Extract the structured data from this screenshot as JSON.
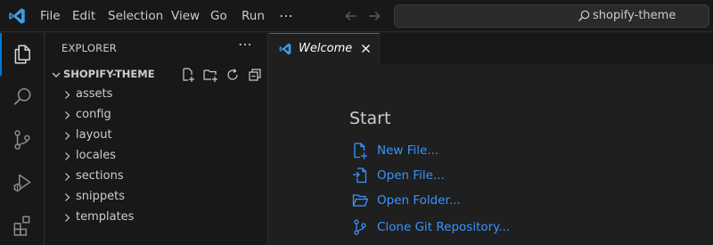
{
  "titlebar": {
    "menu": [
      "File",
      "Edit",
      "Selection",
      "View",
      "Go",
      "Run"
    ],
    "overflow": "⋯",
    "search_text": "shopify-theme"
  },
  "activitybar": {
    "icons": [
      "explorer-icon",
      "search-icon",
      "source-control-icon",
      "run-debug-icon",
      "extensions-icon"
    ],
    "active": "explorer-icon"
  },
  "sidebar": {
    "title": "EXPLORER",
    "more": "⋯",
    "folder": "SHOPIFY-THEME",
    "items": [
      "assets",
      "config",
      "layout",
      "locales",
      "sections",
      "snippets",
      "templates"
    ]
  },
  "editor": {
    "tab_label": "Welcome",
    "start_heading": "Start",
    "start_items": [
      "New File...",
      "Open File...",
      "Open Folder...",
      "Clone Git Repository..."
    ]
  },
  "colors": {
    "accent": "#0078d4",
    "link": "#3794ff",
    "logo": "#3b9de6"
  }
}
